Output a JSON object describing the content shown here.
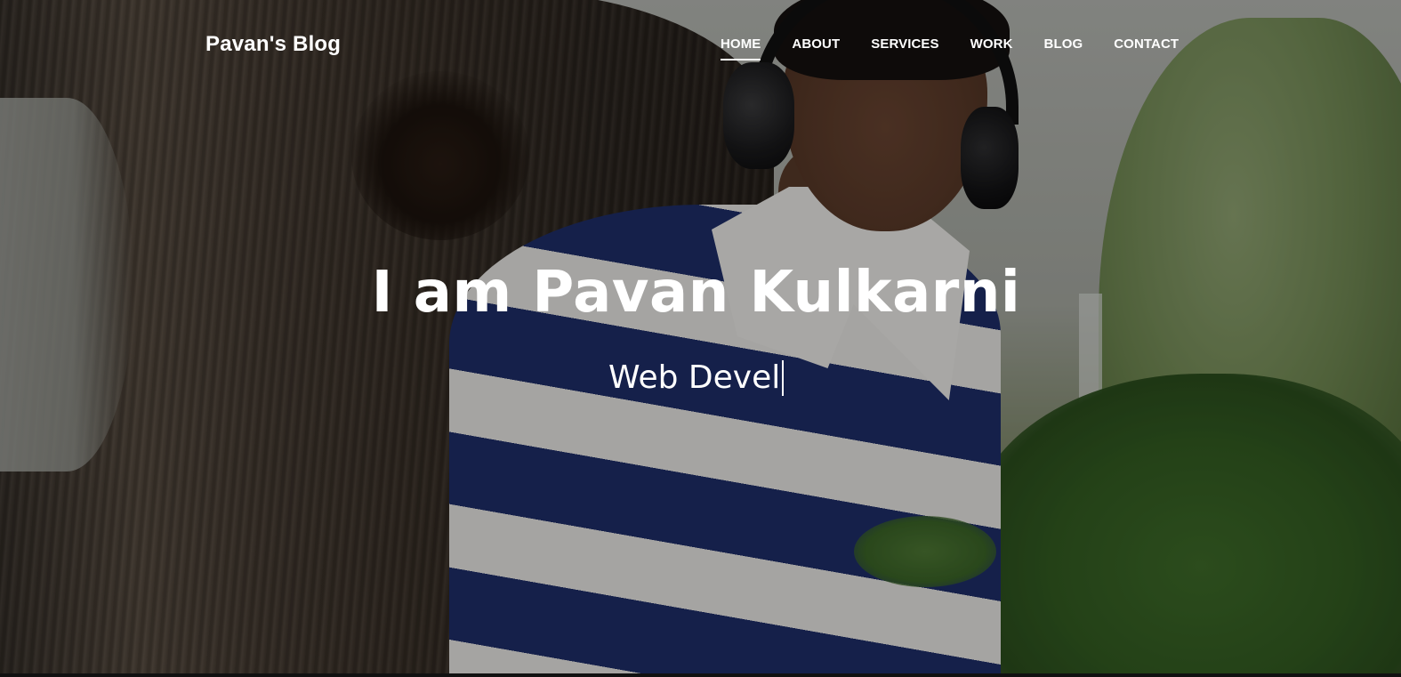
{
  "brand": {
    "name": "Pavan's Blog"
  },
  "nav": {
    "items": [
      {
        "label": "HOME",
        "active": true
      },
      {
        "label": "ABOUT",
        "active": false
      },
      {
        "label": "SERVICES",
        "active": false
      },
      {
        "label": "WORK",
        "active": false
      },
      {
        "label": "BLOG",
        "active": false
      },
      {
        "label": "CONTACT",
        "active": false
      }
    ]
  },
  "hero": {
    "title": "I am Pavan Kulkarni",
    "typed_text": "Web Devel",
    "background_image": "portrait-with-headphones-under-tree",
    "overlay_color": "#000000"
  },
  "colors": {
    "text": "#ffffff",
    "shirt_stripe_navy": "#1f2f6b",
    "shirt_stripe_white": "#ecebe8"
  }
}
